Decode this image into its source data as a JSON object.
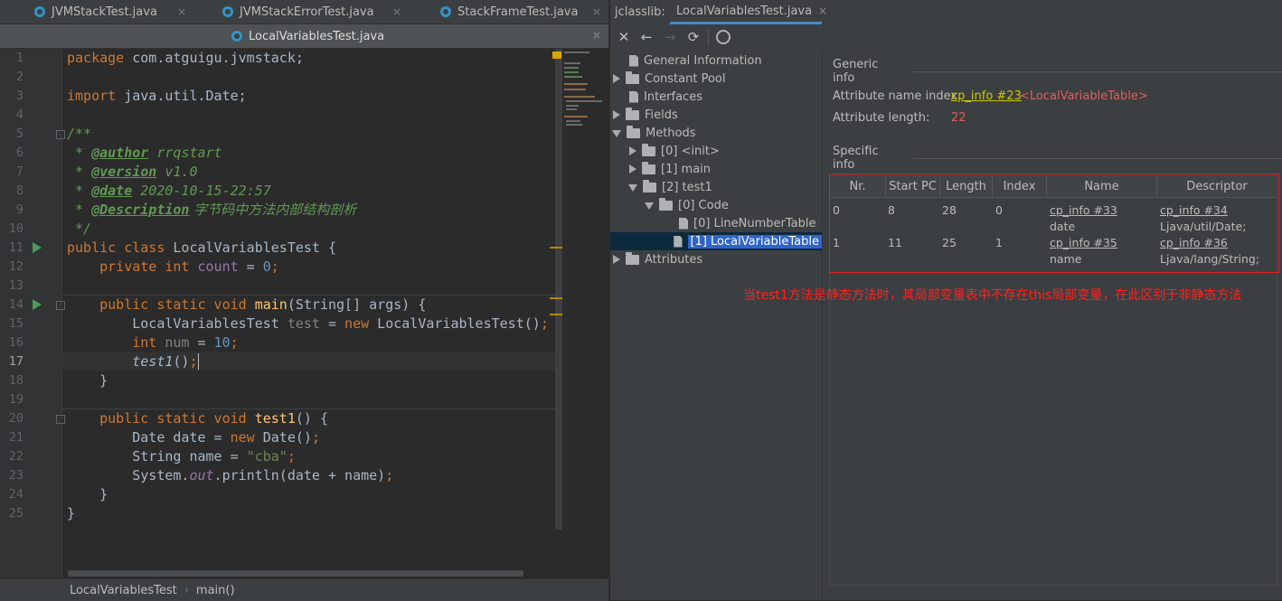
{
  "editor": {
    "tabs": [
      "JVMStackTest.java",
      "JVMStackErrorTest.java",
      "StackFrameTest.java",
      "LocalVariablesTest.java"
    ],
    "tab_close": "×",
    "line_numbers": [
      "1",
      "2",
      "3",
      "4",
      "5",
      "6",
      "7",
      "8",
      "9",
      "10",
      "11",
      "12",
      "13",
      "14",
      "15",
      "16",
      "17",
      "18",
      "19",
      "20",
      "21",
      "22",
      "23",
      "24",
      "25"
    ],
    "code": {
      "l1_kw": "package",
      "l1_rest": " com.atguigu.jvmstack;",
      "l3_kw": "import",
      "l3_rest": " java.util.Date;",
      "l5": "/**",
      "l6_star": " * ",
      "l6_tag": "@author",
      "l6_val": " rrqstart",
      "l7_star": " * ",
      "l7_tag": "@version",
      "l7_val": " v1.0",
      "l8_star": " * ",
      "l8_tag": "@date",
      "l8_val": " 2020-10-15-22:57",
      "l9_star": " * ",
      "l9_tag": "@Description",
      "l9_val": " 字节码中方法内部结构剖析",
      "l10": " */",
      "l11_kw": "public class",
      "l11_rest": " LocalVariablesTest {",
      "l12_kw": "    private int",
      "l12_fld": " count",
      "l12_eq": " = ",
      "l12_num": "0",
      "l12_end": ";",
      "l14_kw": "    public static void",
      "l14_m": " main",
      "l14_rest": "(String[] args) {",
      "l15_a": "        LocalVariablesTest ",
      "l15_v": "test",
      "l15_b": " = ",
      "l15_kw": "new",
      "l15_c": " LocalVariablesTest()",
      "l15_end": ";",
      "l16_kw": "        int",
      "l16_v": " num",
      "l16_eq": " = ",
      "l16_num": "10",
      "l16_end": ";",
      "l17_m": "        test1",
      "l17_rest": "()",
      "l17_end": ";",
      "l18": "    }",
      "l20_kw": "    public static void",
      "l20_m": " test1",
      "l20_rest": "() {",
      "l21_a": "        Date date = ",
      "l21_kw": "new",
      "l21_b": " Date()",
      "l21_end": ";",
      "l22_a": "        String name = ",
      "l22_str": "\"cba\"",
      "l22_end": ";",
      "l23_a": "        System.",
      "l23_f": "out",
      "l23_b": ".println(date + name)",
      "l23_end": ";",
      "l24": "    }",
      "l25": "}"
    },
    "breadcrumb": [
      "LocalVariablesTest",
      "main()"
    ],
    "breadcrumb_sep": "›"
  },
  "jclasslib": {
    "label": "jclasslib:",
    "tab": "LocalVariablesTest.java",
    "tab_close": "×",
    "toolbar": [
      "close-icon",
      "back-icon",
      "forward-icon",
      "refresh-icon",
      "web-icon"
    ],
    "tree": {
      "general": "General Information",
      "constant_pool": "Constant Pool",
      "interfaces": "Interfaces",
      "fields": "Fields",
      "methods": "Methods",
      "init": "[0] <init>",
      "main": "[1] main",
      "test1": "[2] test1",
      "code": "[0] Code",
      "lnt": "[0] LineNumberTable",
      "lvt": "[1] LocalVariableTable",
      "attributes": "Attributes"
    },
    "generic_info": "Generic info",
    "attr_name_label": "Attribute name index:",
    "attr_name_link": "cp_info #23",
    "attr_name_value": "<LocalVariableTable>",
    "attr_len_label": "Attribute length:",
    "attr_len_value": "22",
    "specific_info": "Specific info",
    "columns": [
      "Nr.",
      "Start PC",
      "Length",
      "Index",
      "Name",
      "Descriptor"
    ],
    "rows": [
      {
        "nr": "0",
        "start": "8",
        "length": "28",
        "index": "0",
        "name_link": "cp_info #33",
        "name": "date",
        "desc_link": "cp_info #34",
        "desc": "Ljava/util/Date;"
      },
      {
        "nr": "1",
        "start": "11",
        "length": "25",
        "index": "1",
        "name_link": "cp_info #35",
        "name": "name",
        "desc_link": "cp_info #36",
        "desc": "Ljava/lang/String;"
      }
    ],
    "annotation": "当test1方法是静态方法时，其局部变量表中不存在this局部变量，在此区别于非静态方法"
  },
  "colors": {
    "annotation": "#ff2020",
    "link": "#c8c800",
    "keyword": "#cc7832",
    "selection": "#2f65ca"
  }
}
